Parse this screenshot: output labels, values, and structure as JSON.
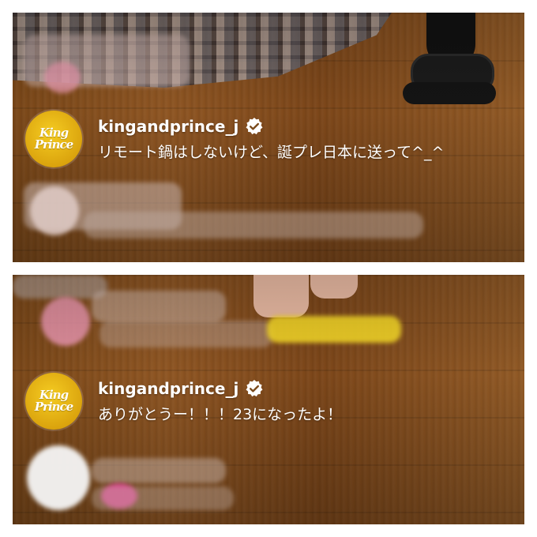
{
  "panels": [
    {
      "username": "kingandprince_j",
      "message": "リモート鍋はしないけど、誕プレ日本に送って^_^",
      "avatar_logo_line1": "King",
      "avatar_logo_line2": "Prince"
    },
    {
      "username": "kingandprince_j",
      "message": "ありがとうー！！！23になったよ！",
      "avatar_logo_line1": "King",
      "avatar_logo_line2": "Prince"
    }
  ],
  "icons": {
    "verified": "verified-badge-icon"
  },
  "colors": {
    "avatar": "#e6b31a",
    "floor": "#7e4a1b",
    "text": "#ffffff"
  }
}
